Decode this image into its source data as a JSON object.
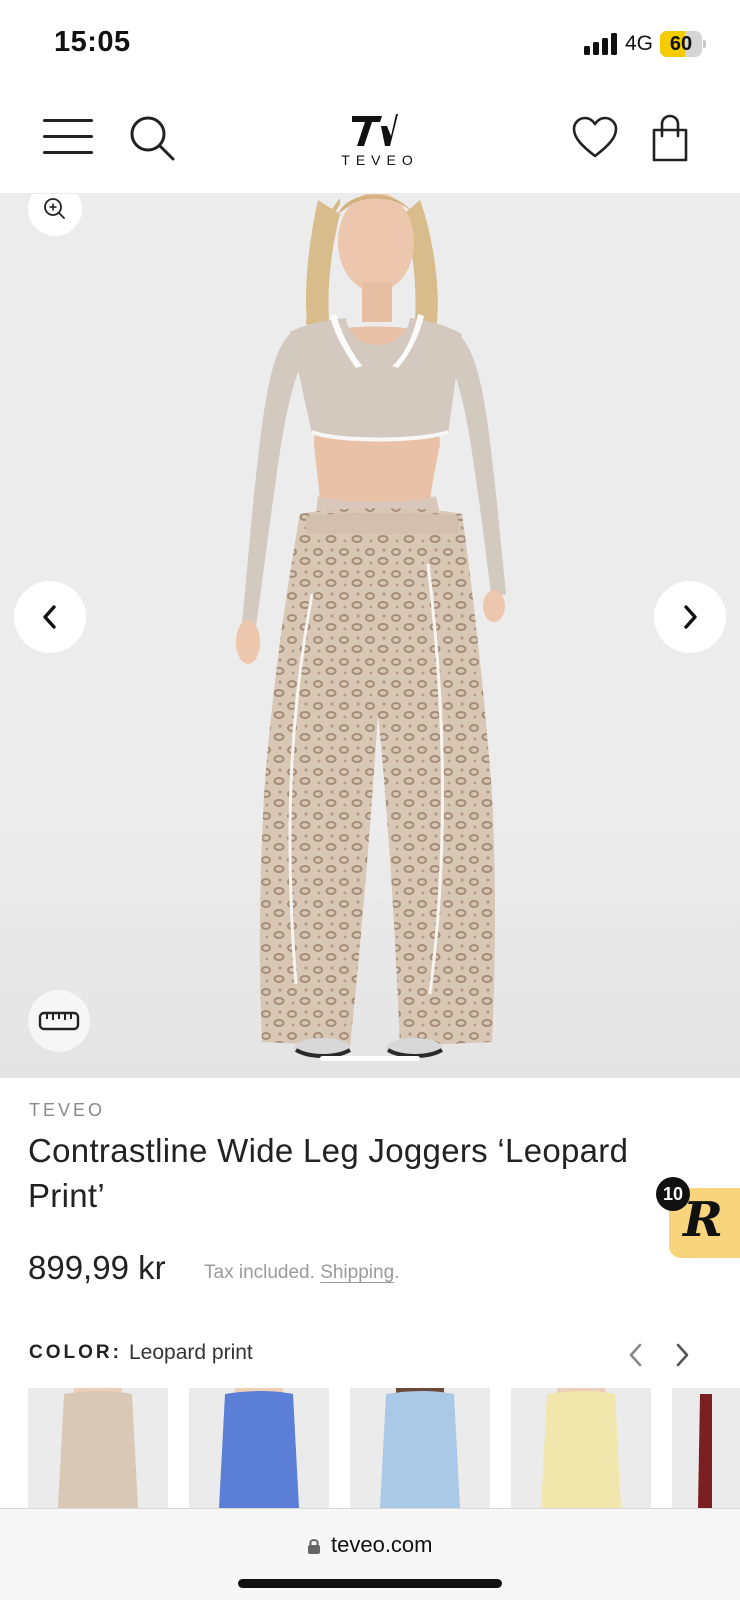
{
  "status_bar": {
    "time": "15:05",
    "network": "4G",
    "battery": "60",
    "battery_level": 0.6
  },
  "header": {
    "logo_text": "TEVEO",
    "icons": [
      "menu-icon",
      "search-icon",
      "heart-icon",
      "shopping-bag-icon"
    ]
  },
  "gallery": {
    "icons": [
      "zoom-in-icon",
      "chevron-left-icon",
      "chevron-right-icon",
      "ruler-icon"
    ]
  },
  "product": {
    "brand": "TEVEO",
    "title": "Contrastline Wide Leg Joggers ‘Leopard Print’",
    "price": "899,99 kr",
    "tax_text": "Tax included. ",
    "shipping_link": "Shipping",
    "tax_suffix": "."
  },
  "rewards": {
    "count": "10",
    "letter": "R",
    "color": "#f8d57c"
  },
  "color_selector": {
    "label": "COLOR:",
    "value": "Leopard print",
    "swatches": [
      {
        "color": "#d9c8b6",
        "name": "leopard"
      },
      {
        "color": "#5b7fd6",
        "name": "blue"
      },
      {
        "color": "#aac9e6",
        "name": "light-blue"
      },
      {
        "color": "#f1e7ad",
        "name": "yellow"
      },
      {
        "color": "#7a1f22",
        "name": "burgundy"
      }
    ]
  },
  "browser": {
    "url": "teveo.com"
  }
}
